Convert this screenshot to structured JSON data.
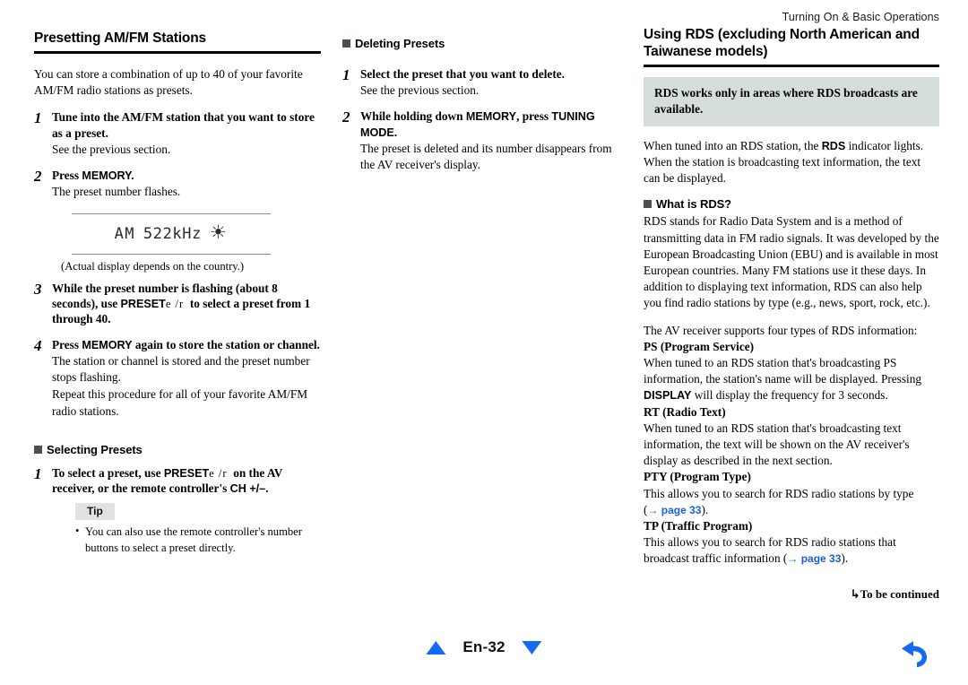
{
  "header": {
    "running_title": "Turning On & Basic Operations"
  },
  "col1": {
    "title": "Presetting AM/FM Stations",
    "intro": "You can store a combination of up to 40 of your favorite AM/FM radio stations as presets.",
    "steps": [
      {
        "num": "1",
        "title_a": "Tune into the AM/FM station that you want to store as a preset.",
        "detail": "See the previous section."
      },
      {
        "num": "2",
        "title_a": "Press ",
        "title_b": "MEMORY.",
        "detail": "The preset number flashes."
      }
    ],
    "figure": {
      "lcd_mode": "AM",
      "lcd_freq": "522kHz",
      "lcd_flash_icon": "flashing-sun-icon",
      "lcd_flash_glyph": "☀",
      "caption": "(Actual display depends on the country.)"
    },
    "step3": {
      "num": "3",
      "part1": "While the preset number is flashing (about 8 seconds), use ",
      "label": "PRESET",
      "arrows": "e /r",
      "part2": "to select a preset from 1 through 40."
    },
    "step4": {
      "num": "4",
      "part1": "Press ",
      "label": "MEMORY",
      "part2": " again to store the station or channel.",
      "detail1": "The station or channel is stored and the preset number stops flashing.",
      "detail2": "Repeat this procedure for all of your favorite AM/FM radio stations."
    },
    "selecting": {
      "heading": "Selecting Presets",
      "bullet_icon": "square-bullet-icon",
      "step": {
        "num": "1",
        "part1": "To select a preset, use ",
        "label1": "PRESET",
        "arrows": "e /r",
        "part2": "on the AV receiver, or the remote controller's ",
        "label2": "CH +/–",
        "part3": "."
      },
      "tip": {
        "badge": "Tip",
        "items": [
          "You can also use the remote controller's number buttons to select a preset directly."
        ]
      }
    }
  },
  "col2": {
    "heading": "Deleting Presets",
    "bullet_icon": "square-bullet-icon",
    "step1": {
      "num": "1",
      "title": "Select the preset that you want to delete.",
      "detail": "See the previous section."
    },
    "step2": {
      "num": "2",
      "part1": "While holding down ",
      "label1": "MEMORY",
      "part2": ", press ",
      "label2": "TUNING MODE.",
      "detail": "The preset is deleted and its number disappears from the AV receiver's display."
    }
  },
  "col3": {
    "title": "Using RDS (excluding North American and Taiwanese models)",
    "callout": "RDS works only in areas where RDS broadcasts are available.",
    "intro_a": "When tuned into an RDS station, the ",
    "intro_label": "RDS",
    "intro_b": " indicator lights. When the station is broadcasting text information, the text can be displayed.",
    "what_is_rds": {
      "heading": "What is RDS?",
      "bullet_icon": "square-bullet-icon",
      "body": "RDS stands for Radio Data System and is a method of transmitting data in FM radio signals. It was developed by the European Broadcasting Union (EBU) and is available in most European countries. Many FM stations use it these days. In addition to displaying text information, RDS can also help you find radio stations by type (e.g., news, sport, rock, etc.)."
    },
    "types_intro": "The AV receiver supports four types of RDS information:",
    "types": [
      {
        "term": "PS (Program Service)",
        "body_a": "When tuned to an RDS station that's broadcasting PS information, the station's name will be displayed. Pressing ",
        "label": "DISPLAY",
        "body_b": " will display the frequency for 3 seconds."
      },
      {
        "term": "RT (Radio Text)",
        "body_a": "When tuned to an RDS station that's broadcasting text information, the text will be shown on the AV receiver's display as described in the next section.",
        "label": "",
        "body_b": ""
      },
      {
        "term": "PTY (Program Type)",
        "body_a": "This allows you to search for RDS radio stations by type (",
        "xref": "→ page 33",
        "body_b": ")."
      },
      {
        "term": "TP (Traffic Program)",
        "body_a": "This allows you to search for RDS radio stations that broadcast traffic information (",
        "xref": "→ page 33",
        "body_b": ")."
      }
    ],
    "to_be_continued": "To be continued",
    "tbc_icon": "hook-arrow-icon"
  },
  "footer": {
    "page_label": "En-32",
    "prev_icon": "triangle-up-icon",
    "next_icon": "triangle-down-icon",
    "back_icon": "back-undo-arrow-icon",
    "accent_blue": "#1569f5",
    "link_blue": "#1b5fe0",
    "callout_bg": "#d5dedb"
  }
}
